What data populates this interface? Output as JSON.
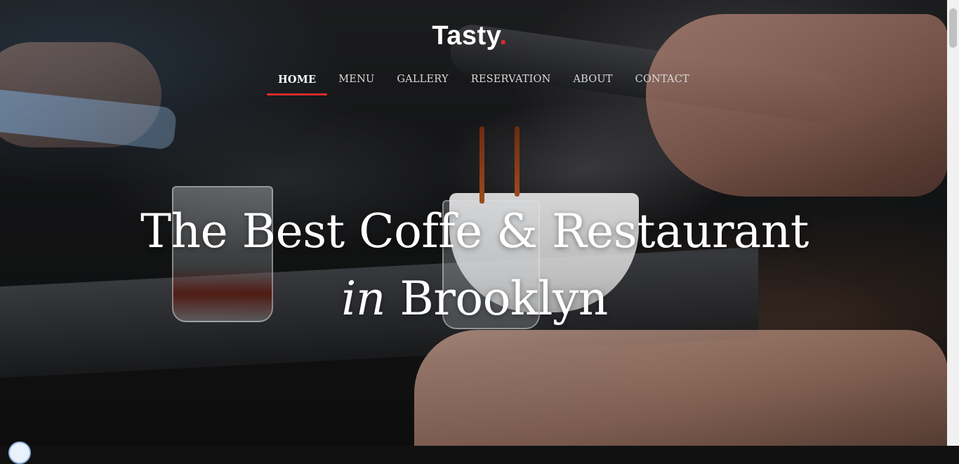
{
  "brand": {
    "name": "Tasty",
    "dot": ".",
    "accent_color": "#e12b2b"
  },
  "nav": {
    "items": [
      {
        "label": "HOME",
        "active": true
      },
      {
        "label": "MENU",
        "active": false
      },
      {
        "label": "GALLERY",
        "active": false
      },
      {
        "label": "RESERVATION",
        "active": false
      },
      {
        "label": "ABOUT",
        "active": false
      },
      {
        "label": "CONTACT",
        "active": false
      }
    ]
  },
  "hero": {
    "headline_line1": "The Best Coffe & Restaurant",
    "headline_line2_italic": "in",
    "headline_line2_rest": "Brooklyn"
  }
}
